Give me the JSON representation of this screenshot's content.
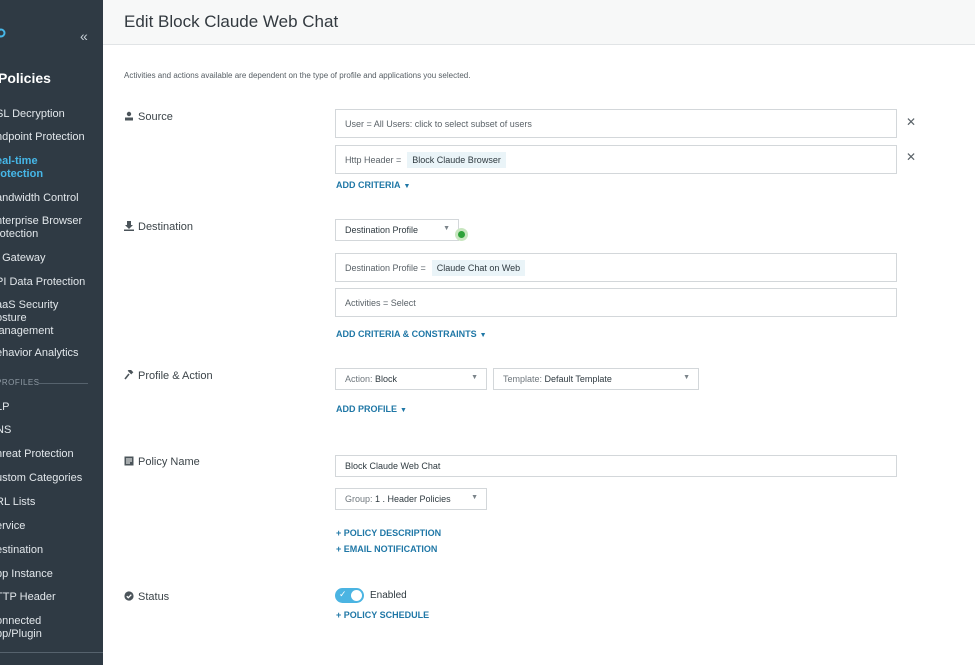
{
  "sidebar": {
    "title": "Policies",
    "collapse_icon": "«",
    "items": [
      {
        "label": "SL Decryption"
      },
      {
        "label": "ndpoint Protection"
      },
      {
        "label": "eal-time\nrotection"
      },
      {
        "label": "andwidth Control"
      },
      {
        "label": "nterprise Browser\nrotection"
      },
      {
        "label": "I Gateway"
      },
      {
        "label": "PI Data Protection"
      },
      {
        "label": "aaS Security\nosture\nlanagement"
      },
      {
        "label": "ehavior Analytics"
      }
    ],
    "profiles_heading": "PROFILES",
    "profile_items": [
      {
        "label": "LP"
      },
      {
        "label": "NS"
      },
      {
        "label": "hreat Protection"
      },
      {
        "label": "ustom Categories"
      },
      {
        "label": "RL Lists"
      },
      {
        "label": "ervice"
      },
      {
        "label": "estination"
      },
      {
        "label": "pp Instance"
      },
      {
        "label": "TTP Header"
      },
      {
        "label": "onnected\npp/Plugin"
      }
    ],
    "active_color": "#46b7e8"
  },
  "header": {
    "title": "Edit Block Claude Web Chat"
  },
  "intro": "Activities and actions available are dependent on the type of profile and applications you selected.",
  "source": {
    "label": "Source",
    "user_field": "User = All Users: click to select subset of users",
    "header_field_prefix": "Http Header =",
    "header_chip": "Block Claude Browser",
    "add_criteria": "ADD CRITERIA"
  },
  "destination": {
    "label": "Destination",
    "type_select": "Destination Profile",
    "profile_prefix": "Destination Profile =",
    "profile_chip": "Claude Chat on Web",
    "activities_field": "Activities = Select",
    "add_criteria": "ADD CRITERIA & CONSTRAINTS"
  },
  "profile_action": {
    "label": "Profile & Action",
    "action_prefix": "Action:",
    "action_value": "Block",
    "template_prefix": "Template:",
    "template_value": "Default Template",
    "add_profile": "ADD PROFILE"
  },
  "policy_name": {
    "label": "Policy Name",
    "value": "Block Claude Web Chat",
    "group_prefix": "Group:",
    "group_value": "1 . Header Policies",
    "policy_description": "+ POLICY DESCRIPTION",
    "email_notification": "+ EMAIL NOTIFICATION"
  },
  "status": {
    "label": "Status",
    "toggle_label": "Enabled",
    "enabled": true,
    "policy_schedule": "+ POLICY SCHEDULE"
  },
  "colors": {
    "accent": "#4bb4e2",
    "link": "#1f77a6",
    "sidebar_bg": "#2f3a44"
  }
}
